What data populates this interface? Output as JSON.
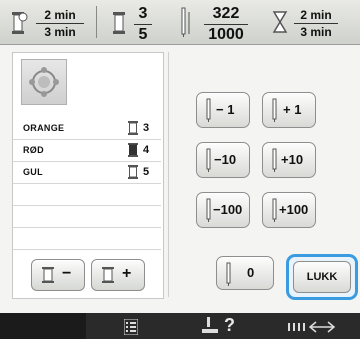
{
  "status": {
    "group1": {
      "num": "2 min",
      "den": "3 min"
    },
    "group2": {
      "num": "3",
      "den": "5"
    },
    "group3": {
      "num": "322",
      "den": "1000"
    },
    "group4": {
      "num": "2 min",
      "den": "3 min"
    }
  },
  "colors": [
    {
      "name": "ORANGE",
      "number": "3"
    },
    {
      "name": "RØD",
      "number": "4"
    },
    {
      "name": "GUL",
      "number": "5"
    }
  ],
  "buttons": {
    "minus1": "− 1",
    "plus1": "+ 1",
    "minus10": "−10",
    "plus10": "+10",
    "minus100": "−100",
    "plus100": "+100",
    "zero": "0",
    "close": "LUKK"
  },
  "bottom": {
    "help": "?"
  },
  "icons": {
    "spool": "thread-spool-icon",
    "needle": "needle-icon",
    "hourglass": "hourglass-icon"
  }
}
